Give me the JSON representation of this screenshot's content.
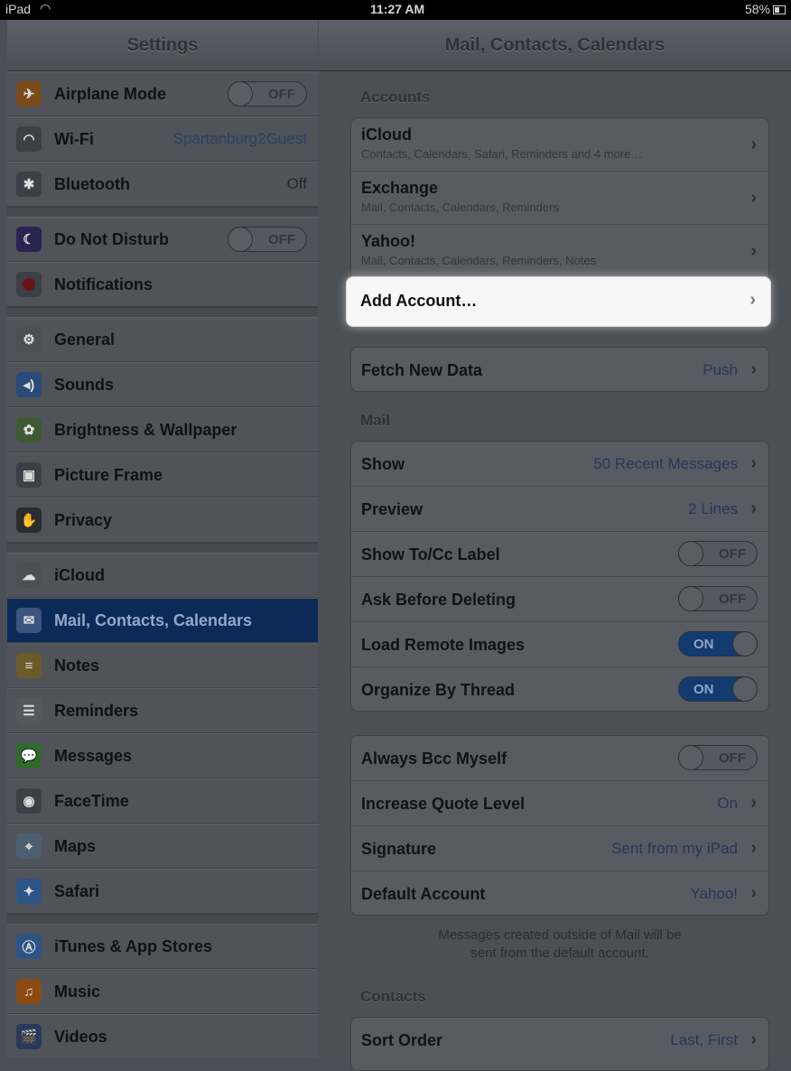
{
  "status": {
    "device": "iPad",
    "time": "11:27 AM",
    "battery": "58%"
  },
  "master": {
    "title": "Settings",
    "items": [
      {
        "label": "Airplane Mode",
        "icon": "airplane-icon",
        "toggle": "OFF"
      },
      {
        "label": "Wi-Fi",
        "icon": "wifi-icon",
        "value": "Spartanburg2Guest"
      },
      {
        "label": "Bluetooth",
        "icon": "bluetooth-icon",
        "value": "Off"
      },
      {
        "label": "Do Not Disturb",
        "icon": "moon-icon",
        "toggle": "OFF"
      },
      {
        "label": "Notifications",
        "icon": "notifications-icon"
      },
      {
        "label": "General",
        "icon": "gear-icon"
      },
      {
        "label": "Sounds",
        "icon": "speaker-icon"
      },
      {
        "label": "Brightness & Wallpaper",
        "icon": "flower-icon"
      },
      {
        "label": "Picture Frame",
        "icon": "picture-frame-icon"
      },
      {
        "label": "Privacy",
        "icon": "hand-icon"
      },
      {
        "label": "iCloud",
        "icon": "cloud-icon"
      },
      {
        "label": "Mail, Contacts, Calendars",
        "icon": "mail-icon"
      },
      {
        "label": "Notes",
        "icon": "notes-icon"
      },
      {
        "label": "Reminders",
        "icon": "reminders-icon"
      },
      {
        "label": "Messages",
        "icon": "messages-icon"
      },
      {
        "label": "FaceTime",
        "icon": "facetime-icon"
      },
      {
        "label": "Maps",
        "icon": "maps-icon"
      },
      {
        "label": "Safari",
        "icon": "safari-icon"
      },
      {
        "label": "iTunes & App Stores",
        "icon": "app-store-icon"
      },
      {
        "label": "Music",
        "icon": "music-icon"
      },
      {
        "label": "Videos",
        "icon": "videos-icon"
      }
    ]
  },
  "detail": {
    "title": "Mail, Contacts, Calendars",
    "accounts_header": "Accounts",
    "accounts": [
      {
        "label": "iCloud",
        "sub": "Contacts, Calendars, Safari, Reminders and 4 more…"
      },
      {
        "label": "Exchange",
        "sub": "Mail, Contacts, Calendars, Reminders"
      },
      {
        "label": "Yahoo!",
        "sub": "Mail, Contacts, Calendars, Reminders, Notes"
      }
    ],
    "add_account": "Add Account…",
    "fetch": {
      "label": "Fetch New Data",
      "value": "Push"
    },
    "mail_header": "Mail",
    "mail": [
      {
        "label": "Show",
        "value": "50 Recent Messages"
      },
      {
        "label": "Preview",
        "value": "2 Lines"
      },
      {
        "label": "Show To/Cc Label",
        "toggle": "OFF"
      },
      {
        "label": "Ask Before Deleting",
        "toggle": "OFF"
      },
      {
        "label": "Load Remote Images",
        "toggle": "ON"
      },
      {
        "label": "Organize By Thread",
        "toggle": "ON"
      }
    ],
    "mail2": [
      {
        "label": "Always Bcc Myself",
        "toggle": "OFF"
      },
      {
        "label": "Increase Quote Level",
        "value": "On"
      },
      {
        "label": "Signature",
        "value": "Sent from my iPad"
      },
      {
        "label": "Default Account",
        "value": "Yahoo!"
      }
    ],
    "note_line1": "Messages created outside of Mail will be",
    "note_line2": "sent from the default account.",
    "contacts_header": "Contacts",
    "sort": {
      "label": "Sort Order",
      "value": "Last, First"
    }
  },
  "colors": {
    "selected": "#0b2a58",
    "toggle_on": "#123b70",
    "value_text": "#233858"
  }
}
